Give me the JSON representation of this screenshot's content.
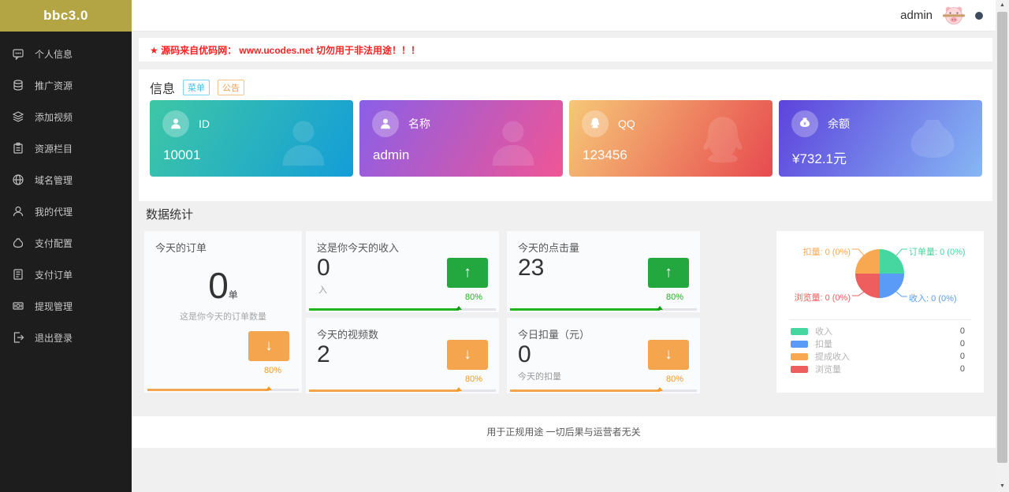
{
  "sidebar": {
    "logo": "bbc3.0",
    "items": [
      {
        "label": "个人信息",
        "icon": "chat-icon"
      },
      {
        "label": "推广资源",
        "icon": "coins-icon"
      },
      {
        "label": "添加视频",
        "icon": "layers-icon"
      },
      {
        "label": "资源栏目",
        "icon": "clipboard-icon"
      },
      {
        "label": "域名管理",
        "icon": "globe-icon"
      },
      {
        "label": "我的代理",
        "icon": "user-icon"
      },
      {
        "label": "支付配置",
        "icon": "moneybag-icon"
      },
      {
        "label": "支付订单",
        "icon": "order-icon"
      },
      {
        "label": "提现管理",
        "icon": "withdraw-icon"
      },
      {
        "label": "退出登录",
        "icon": "logout-icon"
      }
    ]
  },
  "topbar": {
    "username": "admin"
  },
  "notice": {
    "text": "★ 源码来自优码网： www.ucodes.net 切勿用于非法用途！！！",
    "color": "#fb2222"
  },
  "info": {
    "title": "信息",
    "badges": [
      {
        "label": "菜单",
        "color": "#3bc3e6"
      },
      {
        "label": "公告",
        "color": "#f0a04a"
      }
    ],
    "cards": [
      {
        "label": "ID",
        "value": "10001",
        "icon": "user-icon",
        "gradient": [
          "#3ec7a5",
          "#149dd8"
        ]
      },
      {
        "label": "名称",
        "value": "admin",
        "icon": "user-icon",
        "gradient": [
          "#8a5fe8",
          "#f05595"
        ]
      },
      {
        "label": "QQ",
        "value": "123456",
        "icon": "qq-icon",
        "gradient": [
          "#f6c877",
          "#e74a4f"
        ]
      },
      {
        "label": "余额",
        "value": "¥732.1元",
        "icon": "moneybag-icon",
        "gradient": [
          "#5d43dc",
          "#86b7f4"
        ]
      }
    ]
  },
  "stats": {
    "title": "数据统计",
    "cards": [
      {
        "title": "今天的订单",
        "value": "0",
        "unit": "单",
        "subtitle": "这是你今天的订单数量",
        "trend": "down",
        "percent": "80%"
      },
      {
        "title": "这是你今天的收入",
        "value": "0",
        "unit": "入",
        "subtitle": "",
        "trend": "up",
        "percent": "80%"
      },
      {
        "title": "今天的点击量",
        "value": "23",
        "unit": "",
        "subtitle": "",
        "trend": "up",
        "percent": "80%"
      },
      {
        "title": "今天的视频数",
        "value": "2",
        "unit": "",
        "subtitle": "",
        "trend": "down",
        "percent": "80%"
      },
      {
        "title": "今日扣量（元）",
        "value": "0",
        "unit": "",
        "subtitle": "今天的扣量",
        "trend": "down",
        "percent": "80%"
      }
    ],
    "accents": {
      "green_button": "#22a83e",
      "green_bar": "#1db41d",
      "green_text": "#21b321",
      "orange_button": "#f5a54d",
      "orange_bar": "#f5a54d",
      "orange_text": "#f59a23"
    }
  },
  "chart_data": {
    "type": "pie",
    "title": "",
    "slices": [
      {
        "label": "订单量",
        "value": 0,
        "percent": 0,
        "display": "订单量: 0 (0%)",
        "color": "#46d7a0",
        "position": "top-right"
      },
      {
        "label": "收入",
        "value": 0,
        "percent": 0,
        "display": "收入: 0 (0%)",
        "color": "#5b9bf8",
        "position": "bottom-right"
      },
      {
        "label": "浏览量",
        "value": 0,
        "percent": 0,
        "display": "浏览量: 0 (0%)",
        "color": "#ee5e5e",
        "position": "bottom-left"
      },
      {
        "label": "扣量",
        "value": 0,
        "percent": 0,
        "display": "扣量: 0 (0%)",
        "color": "#f9a852",
        "position": "top-left"
      }
    ],
    "layout": {
      "shape": "four equal quadrants",
      "labels": "callout leader lines",
      "legend_position": "bottom-list"
    },
    "legend": [
      {
        "label": "收入",
        "value": "0",
        "color": "#46d7a0"
      },
      {
        "label": "扣量",
        "value": "0",
        "color": "#5b9bf8"
      },
      {
        "label": "提成收入",
        "value": "0",
        "color": "#f9a852"
      },
      {
        "label": "浏览量",
        "value": "0",
        "color": "#ee5e5e"
      }
    ]
  },
  "footer": {
    "text": "用于正规用途 一切后果与运营者无关"
  },
  "theme": {
    "logo_bg": "#b3a444",
    "sidebar_bg": "#1d1d1d",
    "page_bg": "#f0f0f0"
  }
}
